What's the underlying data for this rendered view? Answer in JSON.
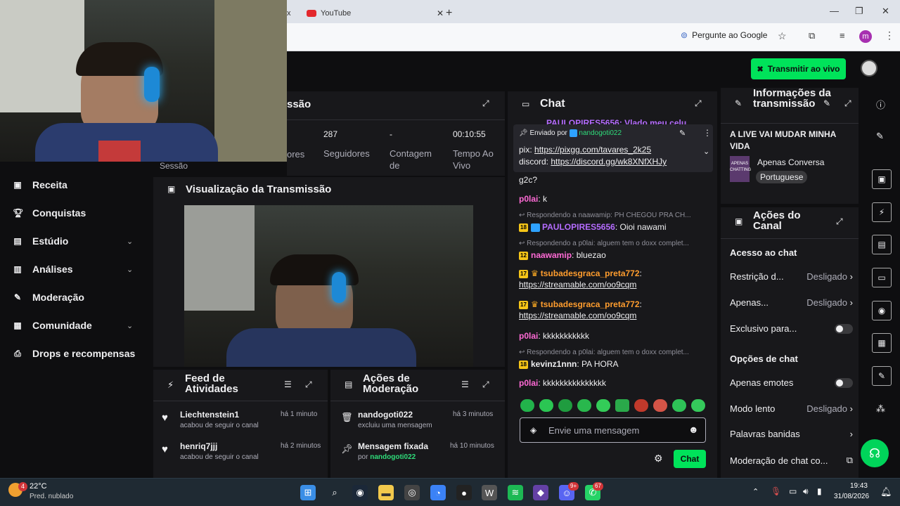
{
  "browser": {
    "tab_close_x": "x",
    "tab_title": "YouTube",
    "ask_google": "Pergunte ao Google",
    "profile_initial": "m"
  },
  "header": {
    "live_button": "Transmitir ao vivo"
  },
  "session": {
    "title_fragment": "ssão",
    "stats": [
      {
        "value": "287",
        "label": "Seguidores"
      },
      {
        "value": "-",
        "label": "Contagem de"
      },
      {
        "value": "00:10:55",
        "label": "Tempo Ao Vivo"
      }
    ],
    "partial_label": "ores",
    "session_label": "Sessão"
  },
  "nav": {
    "items": [
      {
        "label": "Receita"
      },
      {
        "label": "Conquistas"
      },
      {
        "label": "Estúdio"
      },
      {
        "label": "Análises"
      },
      {
        "label": "Moderação"
      },
      {
        "label": "Comunidade"
      },
      {
        "label": "Drops e recompensas"
      }
    ]
  },
  "preview": {
    "title": "Visualização da Transmissão"
  },
  "activity_feed": {
    "title": "Feed de Atividades",
    "items": [
      {
        "name": "Liechtenstein1",
        "action": "acabou de seguir o canal",
        "time": "há 1 minuto"
      },
      {
        "name": "henriq7jjj",
        "action": "acabou de seguir o canal",
        "time": "há 2 minutos"
      }
    ]
  },
  "mod_actions": {
    "title": "Ações de Moderação",
    "items": [
      {
        "name": "nandogoti022",
        "action": "excluiu uma mensagem",
        "time": "há 3 minutos"
      },
      {
        "name": "Mensagem fixada",
        "action_prefix": "por",
        "action_user": "nandogoti022",
        "time": "há 10 minutos"
      }
    ]
  },
  "chat": {
    "title": "Chat",
    "top_partial": "PAULOPIRES5656: Vlado meu celular",
    "pinned": {
      "sent_by_prefix": "Enviado por",
      "sent_by_user": "nandogoti022",
      "line1_prefix": "pix:",
      "line1_link": "https://pixgg.com/tavares_2k25",
      "line2_prefix": "discord:",
      "line2_link": "https://discord.gg/wk8XNfXHJy"
    },
    "messages": [
      {
        "text": "g2c?"
      },
      {
        "user": "p0lai",
        "text": "k"
      },
      {
        "reply": "Respondendo a naawamip: PH CHEGOU PRA CH..."
      },
      {
        "badge": "18",
        "user": "PAULOPIRES5656",
        "text": "Oioi nawami"
      },
      {
        "reply": "Respondendo a p0lai: alguem tem o doxx complet..."
      },
      {
        "badge": "12",
        "user": "naawamip",
        "text": "bluezao"
      },
      {
        "badge": "17",
        "user": "tsubadesgraca_preta772",
        "link": "https://streamable.com/oo9cqm"
      },
      {
        "badge": "17",
        "user": "tsubadesgraca_preta772",
        "link": "https://streamable.com/oo9cqm"
      },
      {
        "user": "p0lai",
        "text": "kkkkkkkkkkk"
      },
      {
        "reply": "Respondendo a p0lai: alguem tem o doxx complet..."
      },
      {
        "badge": "18",
        "user": "kevinz1nnn",
        "text": "PA HORA"
      },
      {
        "user": "p0lai",
        "text": "kkkkkkkkkkkkkkk"
      }
    ],
    "input_placeholder": "Envie uma mensagem",
    "send_button": "Chat"
  },
  "stream_info": {
    "title": "Informações da transmissão",
    "stream_title": "A LIVE VAI MUDAR MINHA VIDA",
    "category": "Apenas Conversa",
    "tag": "Portuguese",
    "thumb_text": "APENAS CHATTING"
  },
  "channel_actions": {
    "title": "Ações do Canal",
    "chat_access_heading": "Acesso ao chat",
    "chat_options_heading": "Opções de chat",
    "rows": [
      {
        "label": "Restrição d...",
        "value": "Desligado"
      },
      {
        "label": "Apenas...",
        "value": "Desligado"
      },
      {
        "label": "Exclusivo para..."
      },
      {
        "label": "Apenas emotes"
      },
      {
        "label": "Modo lento",
        "value": "Desligado"
      },
      {
        "label": "Palavras banidas"
      },
      {
        "label": "Moderação de chat co..."
      }
    ]
  },
  "taskbar": {
    "temperature": "22°C",
    "weather": "Pred. nublado",
    "weather_badge": "4",
    "time": "19:43",
    "date": "31/08/2026",
    "whatsapp_badge": "67",
    "discord_badge": "9+"
  },
  "colors": {
    "accent": "#00e35a",
    "panel": "#18181b",
    "background": "#0e0e10",
    "user_purple": "#b56cff",
    "user_orange": "#ff9d2e",
    "user_pink": "#ff6ad5",
    "user_green": "#2fdc7a"
  }
}
